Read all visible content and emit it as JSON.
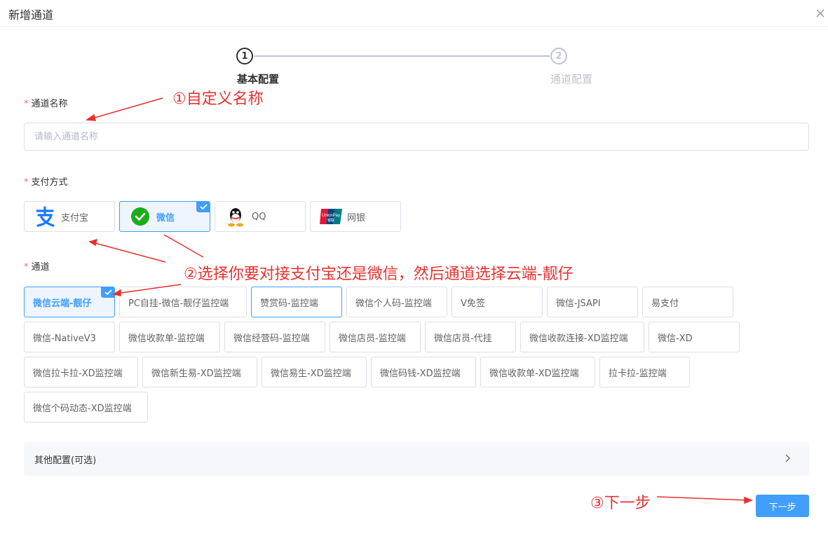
{
  "dialog": {
    "title": "新增通道"
  },
  "steps": [
    {
      "num": "1",
      "label": "基本配置"
    },
    {
      "num": "2",
      "label": "通道配置"
    }
  ],
  "form": {
    "name": {
      "label": "通道名称",
      "placeholder": "请输入通道名称",
      "value": ""
    },
    "pay_method": {
      "label": "支付方式",
      "options": [
        {
          "label": "支付宝",
          "icon": "alipay-icon"
        },
        {
          "label": "微信",
          "icon": "wechat-icon",
          "selected": true
        },
        {
          "label": "QQ",
          "icon": "qq-icon"
        },
        {
          "label": "网银",
          "icon": "unionpay-icon",
          "logo_text": "UnionPay",
          "logo_subtext": "银联"
        }
      ]
    },
    "channel": {
      "label": "通道",
      "options": [
        "微信云端-靓仔",
        "PC自挂-微信-靓仔监控端",
        "赞赏码-监控端",
        "微信个人码-监控端",
        "V免签",
        "微信-JSAPI",
        "易支付",
        "微信-NativeV3",
        "微信收款单-监控端",
        "微信经营码-监控端",
        "微信店员-监控端",
        "微信店员-代挂",
        "微信收款连接-XD监控端",
        "微信-XD",
        "微信拉卡拉-XD监控端",
        "微信新生易-XD监控端",
        "微信易生-XD监控端",
        "微信码钱-XD监控端",
        "微信收款单-XD监控端",
        "拉卡拉-监控端",
        "微信个码动态-XD监控端"
      ],
      "selected_index": 0
    },
    "other_config": {
      "label": "其他配置(可选)"
    },
    "next_label": "下一步"
  },
  "annotations": {
    "a1": "①自定义名称",
    "a2": "②选择你要对接支付宝还是微信，然后通道选择云端-靓仔",
    "a3": "③下一步"
  },
  "colors": {
    "primary": "#409eff",
    "required": "#f56c6c",
    "annotation": "#e8302f",
    "wechat": "#1aad19",
    "alipay": "#1677ff"
  }
}
